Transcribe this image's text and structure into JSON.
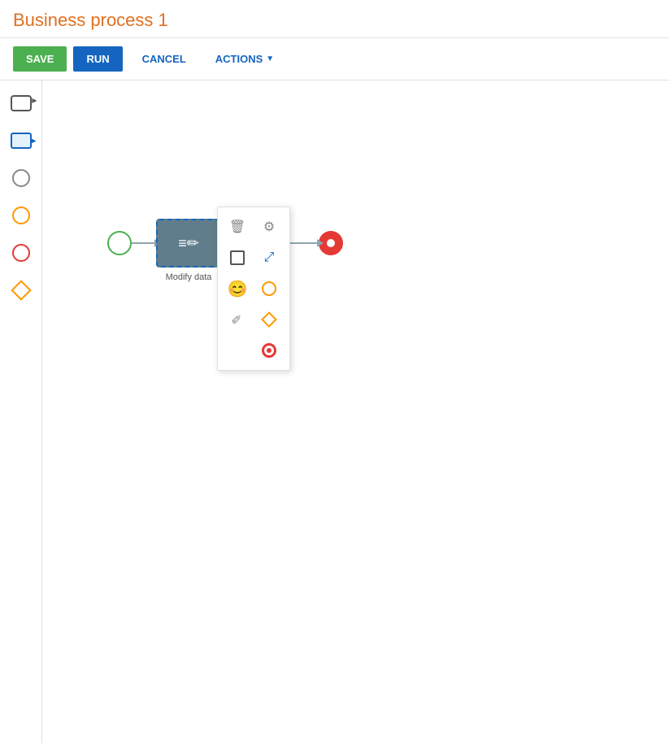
{
  "page": {
    "title": "Business process 1"
  },
  "toolbar": {
    "save_label": "SAVE",
    "run_label": "RUN",
    "cancel_label": "CANCEL",
    "actions_label": "ACTIONS"
  },
  "sidebar": {
    "items": [
      {
        "id": "task",
        "label": "Task"
      },
      {
        "id": "subprocess",
        "label": "Subprocess"
      },
      {
        "id": "circle-plain",
        "label": "Start event"
      },
      {
        "id": "circle-orange",
        "label": "Intermediate event"
      },
      {
        "id": "circle-red",
        "label": "End event"
      },
      {
        "id": "diamond",
        "label": "Gateway"
      }
    ]
  },
  "canvas": {
    "process_node_label": "Modify data"
  },
  "context_menu": {
    "items": [
      {
        "id": "delete",
        "label": "Delete"
      },
      {
        "id": "settings",
        "label": "Settings"
      },
      {
        "id": "task-node",
        "label": "Task node"
      },
      {
        "id": "move",
        "label": "Move"
      },
      {
        "id": "smiley",
        "label": "Smiley"
      },
      {
        "id": "circle",
        "label": "Circle"
      },
      {
        "id": "diamond",
        "label": "Diamond"
      },
      {
        "id": "line",
        "label": "Line"
      },
      {
        "id": "end-event",
        "label": "End event"
      }
    ]
  }
}
